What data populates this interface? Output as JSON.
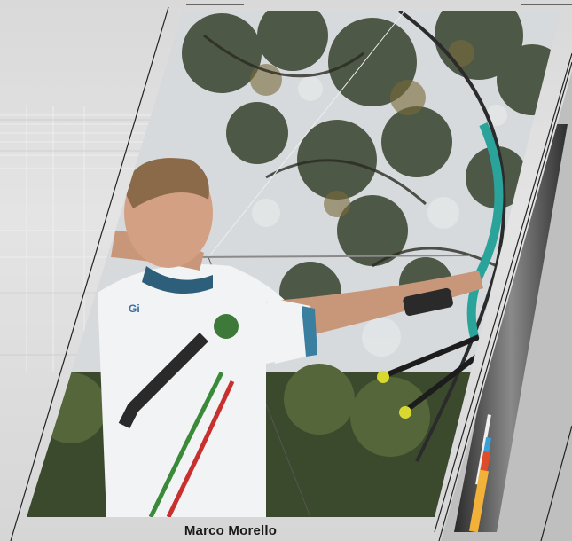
{
  "athlete": {
    "name": "Marco Morello"
  },
  "colors": {
    "background": "#dcdcdc",
    "frame_line": "#222222",
    "bow_riser": "#2aa39a",
    "arrow_shaft": "#3a3a3a",
    "fletch": "#d8d830"
  },
  "images": {
    "main_photo": "archer-drawing-recurve-bow-photo",
    "side_photo": "arrow-shaft-closeup-photo"
  }
}
